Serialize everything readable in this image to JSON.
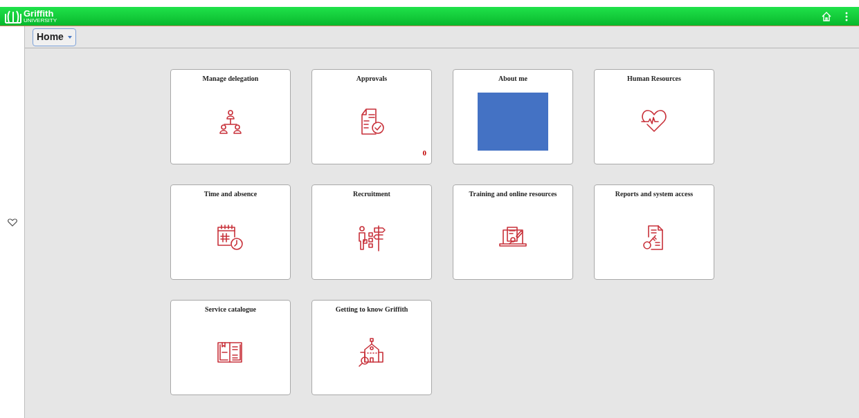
{
  "header": {
    "logo_name": "Griffith",
    "logo_sub": "UNIVERSITY"
  },
  "home_menu": {
    "label": "Home"
  },
  "tiles": [
    {
      "title": "Manage delegation",
      "kind": "org"
    },
    {
      "title": "Approvals",
      "kind": "approve",
      "badge": "0"
    },
    {
      "title": "About me",
      "kind": "redacted"
    },
    {
      "title": "Human Resources",
      "kind": "heart"
    },
    {
      "title": "Time and absence",
      "kind": "calendar"
    },
    {
      "title": "Recruitment",
      "kind": "recruit"
    },
    {
      "title": "Training and online resources",
      "kind": "laptop"
    },
    {
      "title": "Reports and system access",
      "kind": "key"
    },
    {
      "title": "Service catalogue",
      "kind": "book"
    },
    {
      "title": "Getting to know Griffith",
      "kind": "school"
    }
  ]
}
